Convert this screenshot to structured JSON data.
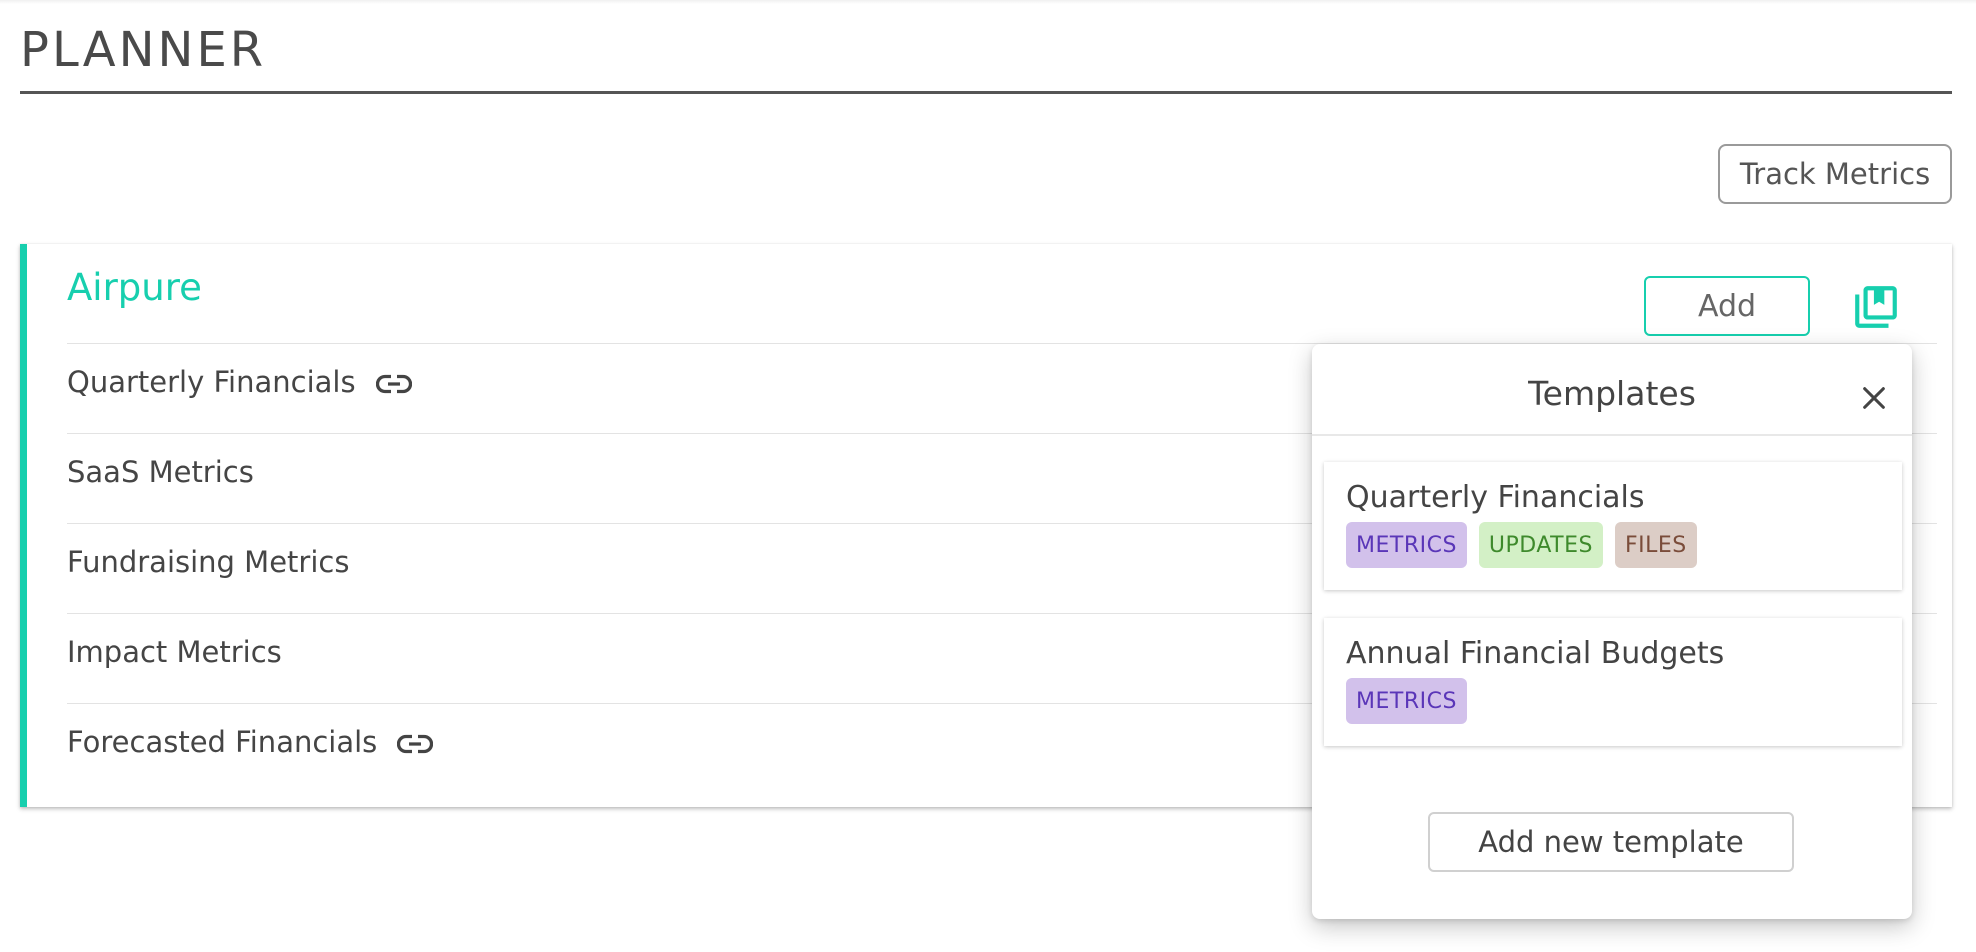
{
  "page": {
    "title": "PLANNER"
  },
  "toolbar": {
    "track_metrics_label": "Track Metrics"
  },
  "company": {
    "name": "Airpure",
    "add_label": "Add",
    "templates_icon": "library-books-icon",
    "metrics": [
      {
        "label": "Quarterly Financials",
        "linked": true
      },
      {
        "label": "SaaS Metrics",
        "linked": false
      },
      {
        "label": "Fundraising Metrics",
        "linked": false
      },
      {
        "label": "Impact Metrics",
        "linked": false
      },
      {
        "label": "Forecasted Financials",
        "linked": true
      }
    ]
  },
  "templates_popover": {
    "title": "Templates",
    "close_icon": "close-icon",
    "templates": [
      {
        "name": "Quarterly Financials",
        "tags": [
          "METRICS",
          "UPDATES",
          "FILES"
        ]
      },
      {
        "name": "Annual Financial Budgets",
        "tags": [
          "METRICS"
        ]
      }
    ],
    "add_new_label": "Add new template"
  },
  "colors": {
    "accent": "#17cfae",
    "tag_metrics_bg": "#d2c1eb",
    "tag_metrics_text": "#5a36b8",
    "tag_updates_bg": "#d3f0c6",
    "tag_updates_text": "#3e8a2c",
    "tag_files_bg": "#dccdc6",
    "tag_files_text": "#7a4c3a"
  }
}
